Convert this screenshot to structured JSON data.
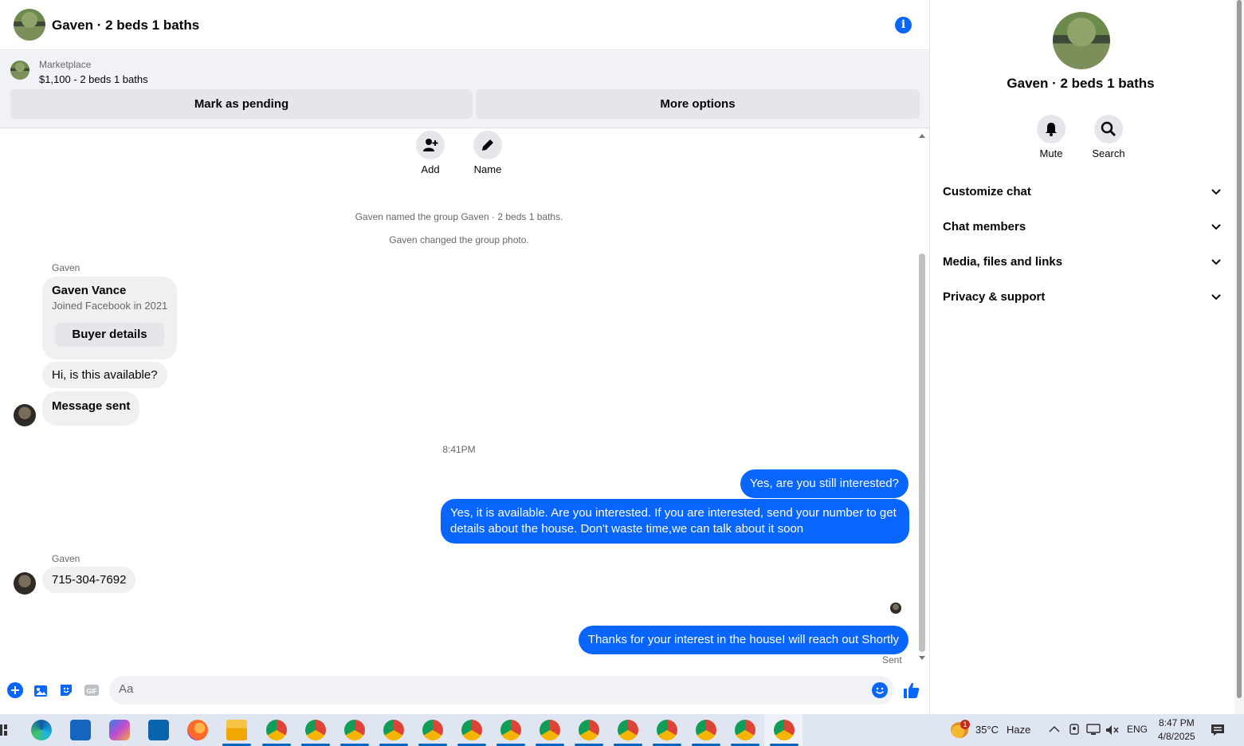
{
  "header": {
    "title": "Gaven · 2 beds 1 baths",
    "info_icon": "info-icon"
  },
  "marketplace": {
    "label": "Marketplace",
    "listing": "$1,100 - 2 beds 1 baths",
    "pending_button": "Mark as pending",
    "more_button": "More options"
  },
  "group_actions": {
    "add_label": "Add",
    "name_label": "Name"
  },
  "system_messages": [
    "Gaven named the group Gaven · 2 beds 1 baths.",
    "Gaven changed the group photo."
  ],
  "messages": {
    "sender1": "Gaven",
    "card": {
      "name": "Gaven Vance",
      "subtitle": "Joined Facebook in 2021",
      "button": "Buyer details"
    },
    "in1": "Hi, is this available?",
    "in2": "Message sent",
    "timestamp": "8:41PM",
    "out1": "Yes, are you still interested?",
    "out2": "Yes, it is available. Are you interested. If you are interested, send your number to get details about the house. Don't waste time,we can talk about it soon",
    "sender2": "Gaven",
    "in3": "715-304-7692",
    "out3": "Thanks for your interest in the houseI will reach out Shortly",
    "status": "Sent"
  },
  "composer": {
    "placeholder": "Aa"
  },
  "sidebar": {
    "title": "Gaven · 2 beds 1 baths",
    "mute_label": "Mute",
    "search_label": "Search",
    "sections": [
      "Customize chat",
      "Chat members",
      "Media, files and links",
      "Privacy & support"
    ]
  },
  "taskbar": {
    "temperature": "35°C",
    "weather": "Haze",
    "weather_badge": "1",
    "language": "ENG",
    "time": "8:47 PM",
    "date": "4/8/2025"
  },
  "colors": {
    "accent": "#0866ff",
    "bubble_in": "#f0f0f0",
    "panel": "#f0f2f5"
  }
}
